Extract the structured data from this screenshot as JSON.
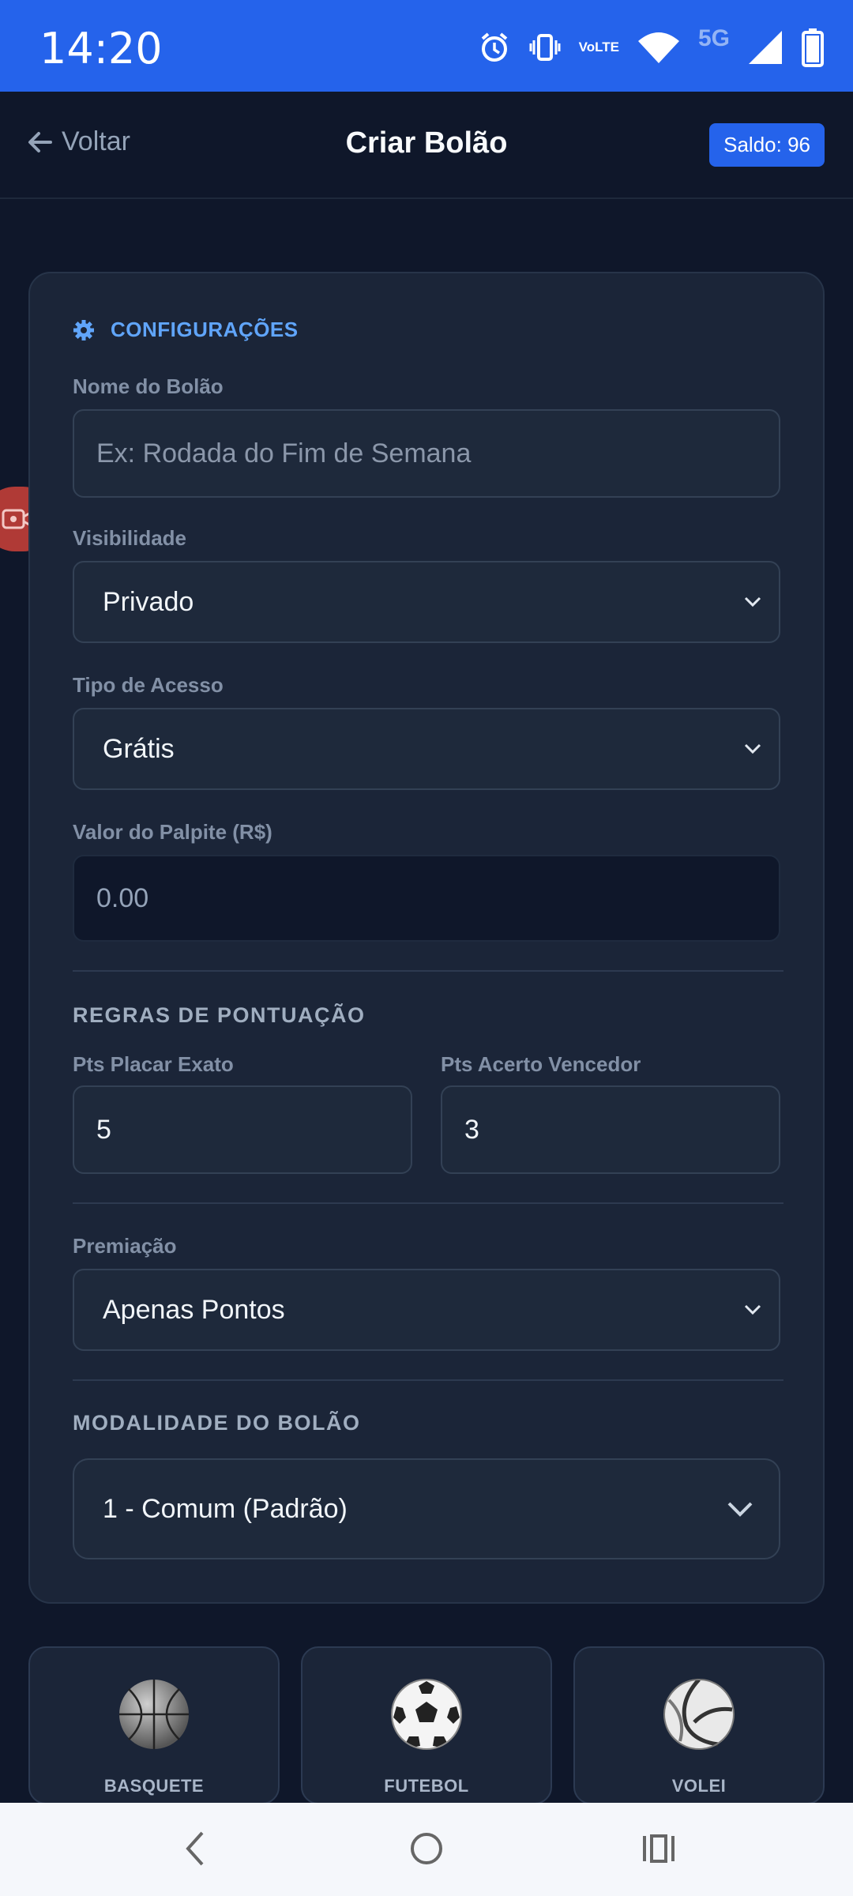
{
  "status_bar": {
    "time": "14:20",
    "lte_top": "Vo",
    "lte_bottom": "LTE",
    "network": "5G"
  },
  "header": {
    "back_label": "Voltar",
    "title": "Criar Bolão",
    "saldo": "Saldo: 96"
  },
  "config": {
    "title": "CONFIGURAÇÕES",
    "name_label": "Nome do Bolão",
    "name_placeholder": "Ex: Rodada do Fim de Semana",
    "visibility_label": "Visibilidade",
    "visibility_value": "Privado",
    "access_label": "Tipo de Acesso",
    "access_value": "Grátis",
    "bet_label": "Valor do Palpite (R$)",
    "bet_value": "0.00"
  },
  "scoring": {
    "title": "REGRAS DE PONTUAÇÃO",
    "exact_label": "Pts Placar Exato",
    "exact_value": "5",
    "winner_label": "Pts Acerto Vencedor",
    "winner_value": "3"
  },
  "prize": {
    "label": "Premiação",
    "value": "Apenas Pontos"
  },
  "mode": {
    "title": "MODALIDADE DO BOLÃO",
    "value": "1 - Comum (Padrão)"
  },
  "sports": [
    {
      "label": "BASQUETE",
      "icon": "basketball-icon"
    },
    {
      "label": "FUTEBOL",
      "icon": "soccer-ball-icon"
    },
    {
      "label": "VOLEI",
      "icon": "volleyball-icon"
    }
  ],
  "colors": {
    "accent": "#2563eb",
    "background": "#0f172a",
    "card": "#1b2538",
    "section": "#60a5fa"
  }
}
